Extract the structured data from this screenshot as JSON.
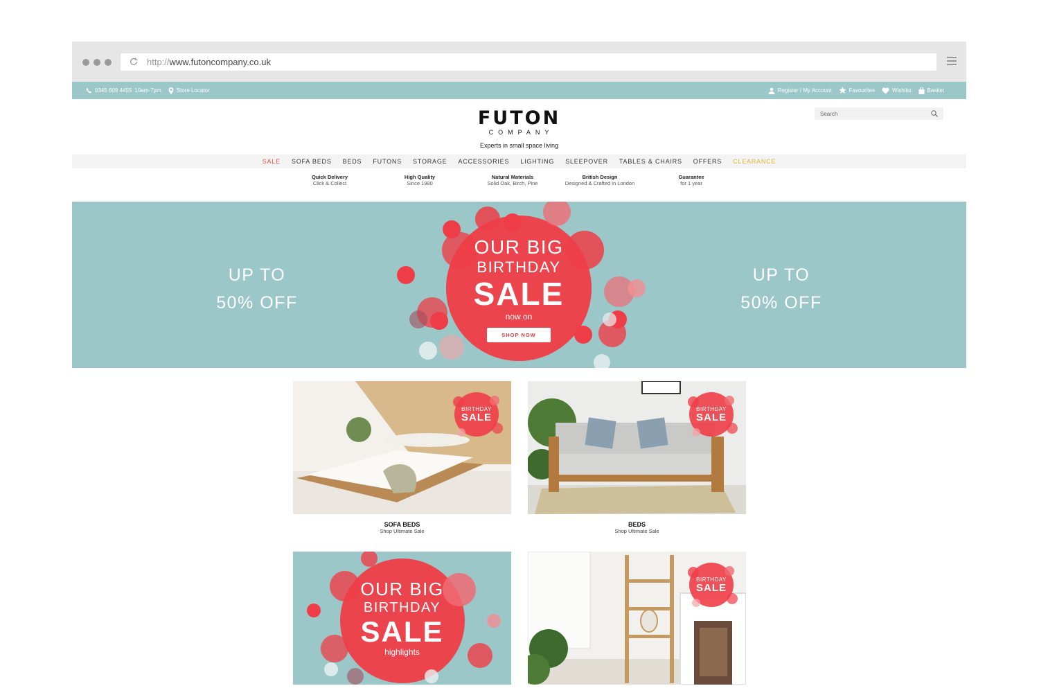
{
  "browser": {
    "url_protocol": "http://",
    "url_host": "www.futoncompany.co.uk"
  },
  "topbar": {
    "phone": "0345 609 4455",
    "hours": "10am-7pm",
    "store_locator": "Store Locator",
    "account": "Register / My Account",
    "favourites": "Favourites",
    "wishlist": "Wishlist",
    "basket": "Basket"
  },
  "header": {
    "logo_main": "FUTON",
    "logo_sub": "COMPANY",
    "tagline": "Experts in small space living",
    "search_placeholder": "Search"
  },
  "nav": [
    "SALE",
    "SOFA BEDS",
    "BEDS",
    "FUTONS",
    "STORAGE",
    "ACCESSORIES",
    "LIGHTING",
    "SLEEPOVER",
    "TABLES & CHAIRS",
    "OFFERS",
    "CLEARANCE"
  ],
  "usps": [
    {
      "title": "Quick Delivery",
      "sub": "Click & Collect"
    },
    {
      "title": "High Quality",
      "sub": "Since 1980"
    },
    {
      "title": "Natural Materials",
      "sub": "Solid Oak, Birch, Pine"
    },
    {
      "title": "British Design",
      "sub": "Designed & Crafted in London"
    },
    {
      "title": "Guarantee",
      "sub": "for 1 year"
    }
  ],
  "hero": {
    "left_l1": "UP TO",
    "left_l2": "50% OFF",
    "right_l1": "UP TO",
    "right_l2": "50% OFF",
    "line1": "OUR BIG",
    "line2": "BIRTHDAY",
    "line3": "SALE",
    "line4": "now on",
    "cta": "SHOP NOW"
  },
  "tiles": [
    {
      "badge_l1": "BIRTHDAY",
      "badge_l2": "SALE",
      "title": "SOFA BEDS",
      "sub": "Shop Ultimate Sale"
    },
    {
      "badge_l1": "BIRTHDAY",
      "badge_l2": "SALE",
      "title": "BEDS",
      "sub": "Shop Ultimate Sale"
    },
    {
      "line1": "OUR BIG",
      "line2": "BIRTHDAY",
      "line3": "SALE",
      "line4": "highlights"
    },
    {
      "badge_l1": "BIRTHDAY",
      "badge_l2": "SALE"
    }
  ],
  "colors": {
    "teal": "#9cc7c9",
    "sale_red": "#e2574c",
    "clearance_yellow": "#e4b53a",
    "confetti_red": "#ef3d47"
  }
}
